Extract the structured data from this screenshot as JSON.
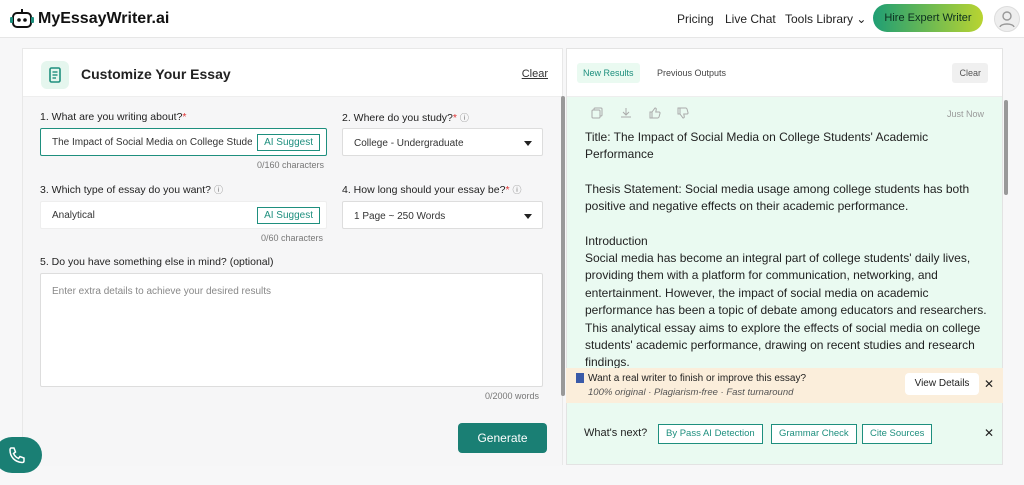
{
  "brand": {
    "name": "MyEssayWriter.ai"
  },
  "nav": {
    "pricing": "Pricing",
    "live_chat": "Live Chat",
    "tools_library": "Tools Library",
    "hire_cta": "Hire Expert Writer"
  },
  "form": {
    "title": "Customize Your Essay",
    "clear_label": "Clear",
    "q1": {
      "label": "1. What are you writing about?",
      "value": "The Impact of Social Media on College Stude",
      "ai_suggest": "AI Suggest",
      "counter": "0/160 characters"
    },
    "q2": {
      "label": "2. Where do you study?",
      "value": "College - Undergraduate"
    },
    "q3": {
      "label": "3. Which type of essay do you want?",
      "value": "Analytical",
      "ai_suggest": "AI Suggest",
      "counter": "0/60 characters"
    },
    "q4": {
      "label": "4. How long should your essay be?",
      "value": "1 Page ~ 250 Words"
    },
    "q5": {
      "label": "5. Do you have something else in mind? (optional)",
      "placeholder": "Enter extra details to achieve your desired results",
      "counter": "0/2000 words"
    },
    "required_mark": "*",
    "generate_label": "Generate"
  },
  "results": {
    "tabs": [
      {
        "label": "New Results",
        "active": true
      },
      {
        "label": "Previous Outputs",
        "active": false
      }
    ],
    "clear_label": "Clear",
    "toolbar_icons": [
      "copy-icon",
      "download-icon",
      "thumbs-up-icon",
      "thumbs-down-icon"
    ],
    "timestamp": "Just Now",
    "paragraphs": [
      "Title: The Impact of Social Media on College Students' Academic Performance",
      "Thesis Statement: Social media usage among college students has both positive and negative effects on their academic performance.",
      "Introduction\nSocial media has become an integral part of college students' daily lives, providing them with a platform for communication, networking, and entertainment. However, the impact of social media on academic performance has been a topic of debate among educators and researchers. This analytical essay aims to explore the effects of social media on college students' academic performance, drawing on recent studies and research findings."
    ],
    "promo": {
      "title": "Want a real writer to finish or improve this essay?",
      "subtitle": "100% original · Plagiarism-free · Fast turnaround",
      "cta": "View Details"
    },
    "next": {
      "label": "What's next?",
      "chips": [
        "By Pass AI Detection",
        "Grammar Check",
        "Cite Sources"
      ]
    }
  },
  "colors": {
    "accent": "#1a7f74",
    "result_bg": "#eafaf1",
    "promo_bg": "#fbeedb"
  }
}
